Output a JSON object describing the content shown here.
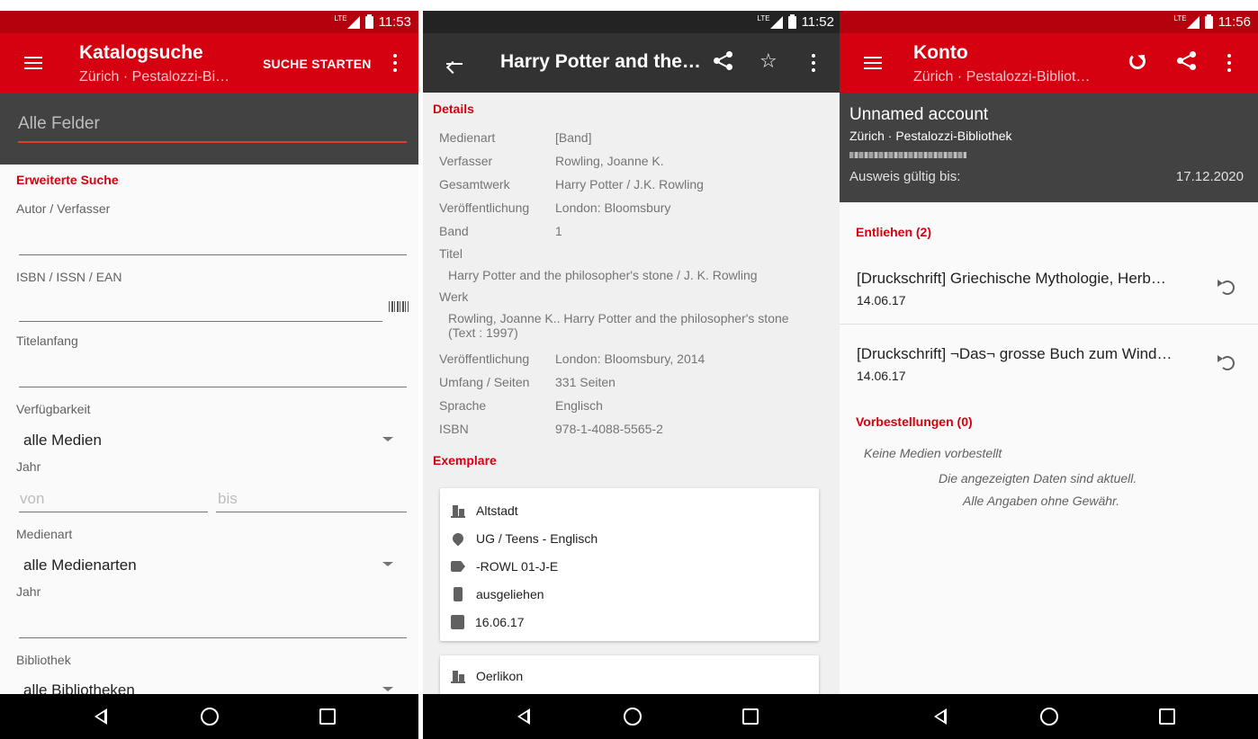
{
  "status": {
    "p1_time": "11:53",
    "p2_time": "11:52",
    "p3_time": "11:56",
    "network": "LTE"
  },
  "colors": {
    "accent_red": "#d50010",
    "dark_toolbar": "#323232",
    "gray_header": "#424242"
  },
  "search": {
    "title": "Katalogsuche",
    "subtitle": "Zürich · Pestalozzi-Bi…",
    "action": "SUCHE STARTEN",
    "all_fields_placeholder": "Alle Felder",
    "advanced_title": "Erweiterte Suche",
    "author_label": "Autor / Verfasser",
    "isbn_label": "ISBN / ISSN / EAN",
    "title_start_label": "Titelanfang",
    "availability_label": "Verfügbarkeit",
    "availability_value": "alle Medien",
    "year_label": "Jahr",
    "year_from": "von",
    "year_to": "bis",
    "media_type_label": "Medienart",
    "media_type_value": "alle Medienarten",
    "year2_label": "Jahr",
    "library_label": "Bibliothek",
    "library_value": "alle Bibliotheken"
  },
  "detail": {
    "title": "Harry Potter and the…",
    "section_details": "Details",
    "rows": [
      {
        "label": "Medienart",
        "value": "[Band]"
      },
      {
        "label": "Verfasser",
        "value": "Rowling, Joanne K."
      },
      {
        "label": "Gesamtwerk",
        "value": "Harry Potter / J.K. Rowling"
      },
      {
        "label": "Veröffentlichung",
        "value": "London: Bloomsbury"
      },
      {
        "label": "Band",
        "value": "1"
      }
    ],
    "titel_label": "Titel",
    "titel_value": "Harry Potter and the philosopher's stone / J. K. Rowling",
    "werk_label": "Werk",
    "werk_value": "Rowling, Joanne K.. Harry Potter and the philosopher's stone (Text : 1997)",
    "rows2": [
      {
        "label": "Veröffentlichung",
        "value": "London: Bloomsbury, 2014"
      },
      {
        "label": "Umfang / Seiten",
        "value": "331  Seiten"
      },
      {
        "label": "Sprache",
        "value": "Englisch"
      },
      {
        "label": "ISBN",
        "value": "978-1-4088-5565-2"
      }
    ],
    "section_copies": "Exemplare",
    "copy1": {
      "branch": "Altstadt",
      "location": "UG / Teens - Englisch",
      "shelfmark": "-ROWL 01-J-E",
      "status": "ausgeliehen",
      "return_date": "16.06.17"
    },
    "copy2": {
      "branch": "Oerlikon"
    },
    "icons": [
      "back-arrow-icon",
      "share-icon",
      "star-icon",
      "more-vert-icon",
      "building-icon",
      "location-pin-icon",
      "tag-icon",
      "traffic-light-icon",
      "clipboard-return-icon"
    ]
  },
  "account": {
    "title": "Konto",
    "subtitle": "Zürich · Pestalozzi-Bibliot…",
    "name": "Unnamed account",
    "library": "Zürich · Pestalozzi-Bibliothek",
    "card_valid_label": "Ausweis gültig bis:",
    "card_valid_date": "17.12.2020",
    "lent_title": "Entliehen (2)",
    "lent_items": [
      {
        "title": "[Druckschrift] Griechische Mythologie, Herb…",
        "date": "14.06.17"
      },
      {
        "title": "[Druckschrift] ¬Das¬ grosse Buch zum Wind…",
        "date": "14.06.17"
      }
    ],
    "reservations_title": "Vorbestellungen (0)",
    "no_reservations": "Keine Medien vorbestellt",
    "disclaimer_1": "Die angezeigten Daten sind aktuell.",
    "disclaimer_2": "Alle Angaben ohne Gewähr."
  }
}
